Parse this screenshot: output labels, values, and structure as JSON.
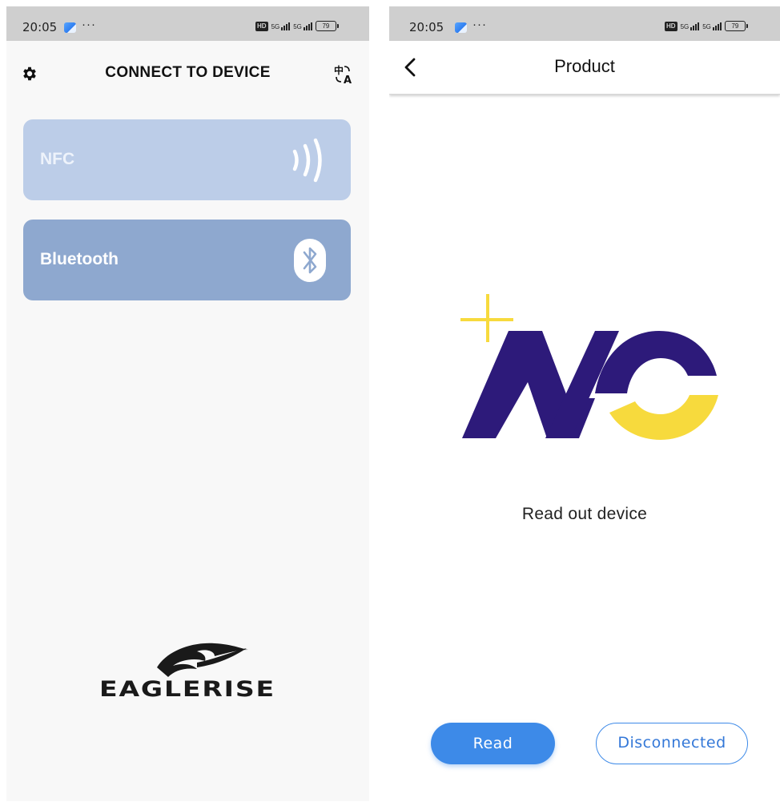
{
  "status_bar": {
    "time": "20:05",
    "dots": "···",
    "hd_label": "HD",
    "sim1_label": "5G",
    "sim2_label": "5G",
    "battery": "79"
  },
  "connect_screen": {
    "title": "CONNECT TO DEVICE",
    "options": [
      {
        "label": "NFC",
        "icon": "nfc-waves-icon",
        "color": "#bccde8"
      },
      {
        "label": "Bluetooth",
        "icon": "bluetooth-icon",
        "color": "#8ea8cf"
      }
    ],
    "brand": "EAGLERISE"
  },
  "product_screen": {
    "title": "Product",
    "logo": "nc-logo",
    "status": "Read out device",
    "read_button": "Read",
    "disconnect_button": "Disconnected"
  },
  "colors": {
    "accent": "#3d8ae8",
    "nc_purple": "#2d1a7a",
    "nc_yellow": "#f7da3d"
  }
}
